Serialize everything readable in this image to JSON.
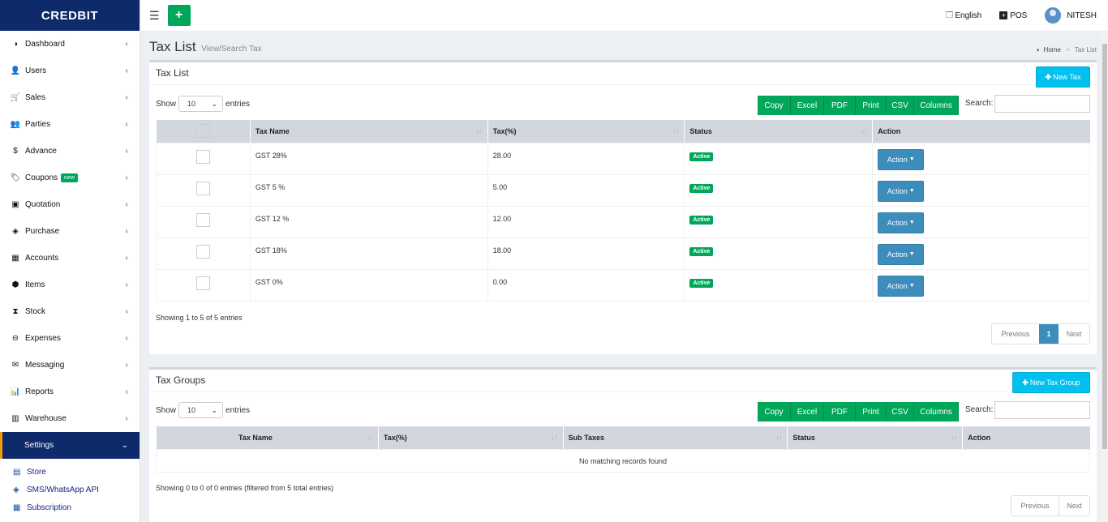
{
  "brand": "CREDBIT",
  "sidebar": {
    "items": [
      {
        "label": "Dashboard",
        "icon": "dashboard-icon",
        "glyph": "◑"
      },
      {
        "label": "Users",
        "icon": "user-plus-icon",
        "glyph": "👤"
      },
      {
        "label": "Sales",
        "icon": "cart-icon",
        "glyph": "🛒"
      },
      {
        "label": "Parties",
        "icon": "users-icon",
        "glyph": "👥"
      },
      {
        "label": "Advance",
        "icon": "dollar-icon",
        "glyph": "$"
      },
      {
        "label": "Coupons",
        "icon": "tags-icon",
        "glyph": "🏷",
        "badge": "new"
      },
      {
        "label": "Quotation",
        "icon": "calendar-plus-icon",
        "glyph": "▣"
      },
      {
        "label": "Purchase",
        "icon": "cube-icon",
        "glyph": "◈"
      },
      {
        "label": "Accounts",
        "icon": "grid-icon",
        "glyph": "▦"
      },
      {
        "label": "Items",
        "icon": "cubes-icon",
        "glyph": "⬢"
      },
      {
        "label": "Stock",
        "icon": "hourglass-icon",
        "glyph": "⧗"
      },
      {
        "label": "Expenses",
        "icon": "minus-circle-icon",
        "glyph": "⊖"
      },
      {
        "label": "Messaging",
        "icon": "envelope-icon",
        "glyph": "✉"
      },
      {
        "label": "Reports",
        "icon": "bar-chart-icon",
        "glyph": "📊"
      },
      {
        "label": "Warehouse",
        "icon": "building-icon",
        "glyph": "▥"
      },
      {
        "label": "Settings",
        "icon": "",
        "glyph": "",
        "active": true
      }
    ],
    "sub_items": [
      {
        "label": "Store",
        "icon": "store-icon",
        "glyph": "▤"
      },
      {
        "label": "SMS/WhatsApp API",
        "icon": "cube-icon",
        "glyph": "◈"
      },
      {
        "label": "Subscription",
        "icon": "calendar-icon",
        "glyph": "▦"
      }
    ]
  },
  "header": {
    "language": "English",
    "pos": "POS",
    "user": "NITESH"
  },
  "page": {
    "title": "Tax List",
    "subtitle": "View/Search Tax",
    "breadcrumb_home": "Home",
    "breadcrumb_current": "Tax List"
  },
  "tax_list": {
    "title": "Tax List",
    "new_button": "New Tax",
    "show_label": "Show",
    "entries_label": "entries",
    "page_length": "10",
    "export_buttons": [
      "Copy",
      "Excel",
      "PDF",
      "Print",
      "CSV",
      "Columns"
    ],
    "search_label": "Search:",
    "columns": [
      "Tax Name",
      "Tax(%)",
      "Status",
      "Action"
    ],
    "rows": [
      {
        "name": "GST 28%",
        "tax": "28.00",
        "status": "Active",
        "action": "Action"
      },
      {
        "name": "GST 5 %",
        "tax": "5.00",
        "status": "Active",
        "action": "Action"
      },
      {
        "name": "GST 12 %",
        "tax": "12.00",
        "status": "Active",
        "action": "Action"
      },
      {
        "name": "GST 18%",
        "tax": "18.00",
        "status": "Active",
        "action": "Action"
      },
      {
        "name": "GST 0%",
        "tax": "0.00",
        "status": "Active",
        "action": "Action"
      }
    ],
    "info": "Showing 1 to 5 of 5 entries",
    "pager": {
      "prev": "Previous",
      "current": "1",
      "next": "Next"
    }
  },
  "tax_groups": {
    "title": "Tax Groups",
    "new_button": "New Tax Group",
    "show_label": "Show",
    "entries_label": "entries",
    "page_length": "10",
    "export_buttons": [
      "Copy",
      "Excel",
      "PDF",
      "Print",
      "CSV",
      "Columns"
    ],
    "search_label": "Search:",
    "columns": [
      "Tax Name",
      "Tax(%)",
      "Sub Taxes",
      "Status",
      "Action"
    ],
    "empty": "No matching records found",
    "info": "Showing 0 to 0 of 0 entries (filtered from 5 total entries)",
    "pager": {
      "prev": "Previous",
      "next": "Next"
    }
  },
  "colors": {
    "brand": "#0e2a6b",
    "success": "#00a65a",
    "info": "#00c0ef",
    "primary": "#3c8dbc"
  }
}
